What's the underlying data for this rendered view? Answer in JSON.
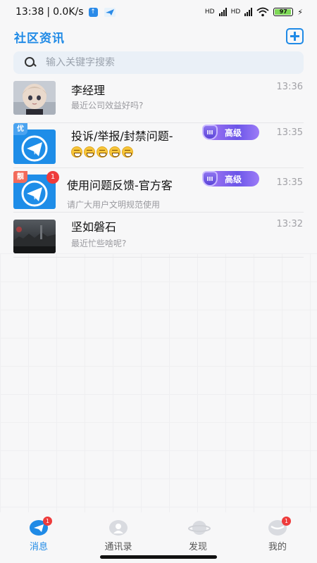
{
  "status_bar": {
    "time": "13:38",
    "net_speed": "0.0K/s",
    "battery": "97",
    "hd1": "HD",
    "hd2": "HD"
  },
  "header": {
    "title": "社区资讯",
    "add_icon": "plus-square-icon"
  },
  "search": {
    "placeholder": "输入关键字搜索",
    "value": ""
  },
  "conversations": [
    {
      "name": "李经理",
      "preview": "最近公司效益好吗?",
      "time": "13:36",
      "avatar": "anime-girl-avatar"
    },
    {
      "name": "投诉/举报/封禁问题-",
      "preview": "",
      "time": "13:35",
      "badge": "高级",
      "tag": "优",
      "tag_color": "#4aa3f0",
      "avatar": "telegram-logo-avatar",
      "emoji_count": 5
    },
    {
      "name": "使用问题反馈-官方客",
      "preview": "请广大用户文明规范使用",
      "time": "13:35",
      "badge": "高级",
      "tag": "靓",
      "tag_color": "#f26a5a",
      "unread": "1",
      "avatar": "telegram-logo-avatar"
    },
    {
      "name": "坚如磐石",
      "preview": "最近忙些啥呢?",
      "time": "13:32",
      "avatar": "dark-city-avatar"
    }
  ],
  "tabbar": {
    "tabs": [
      {
        "label": "消息",
        "icon": "paper-plane-icon",
        "badge": "1",
        "active": true
      },
      {
        "label": "通讯录",
        "icon": "contacts-icon"
      },
      {
        "label": "发现",
        "icon": "planet-icon"
      },
      {
        "label": "我的",
        "icon": "profile-icon",
        "badge": "1"
      }
    ]
  },
  "colors": {
    "accent": "#1f8ae6",
    "badge_red": "#ee3b3b",
    "pro_purple": "#6b55e8"
  }
}
